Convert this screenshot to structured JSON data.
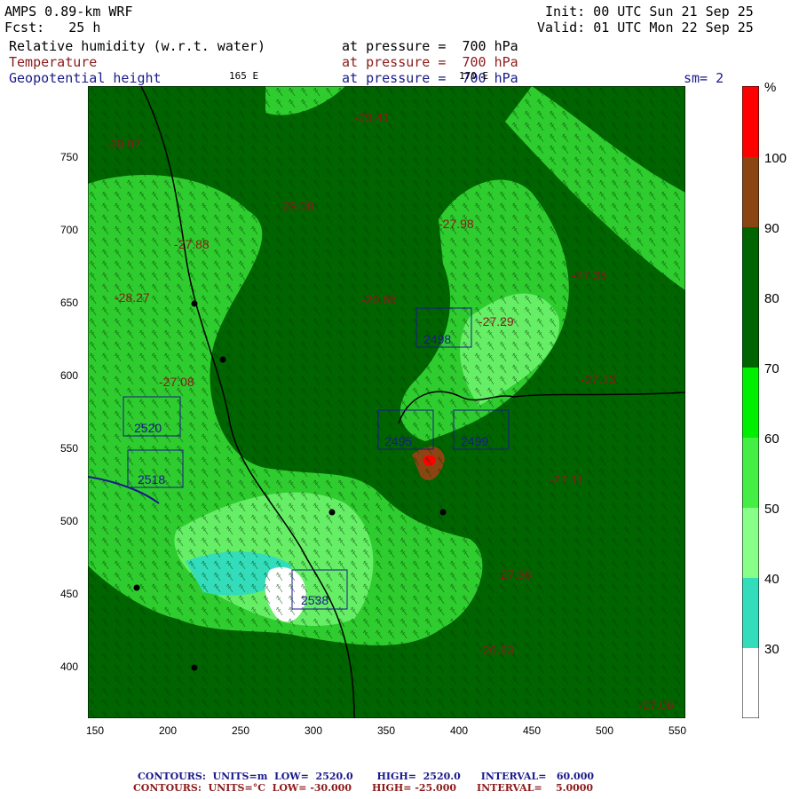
{
  "header": {
    "model": "AMPS 0.89-km WRF",
    "init": "Init: 00 UTC Sun 21 Sep 25",
    "fcst": "Fcst:   25 h",
    "valid": "Valid: 01 UTC Mon 22 Sep 25",
    "fields": [
      {
        "name": "Relative humidity (w.r.t. water)",
        "level": "at pressure =  700 hPa"
      },
      {
        "name": "Temperature",
        "level": "at pressure =  700 hPa"
      },
      {
        "name": "Geopotential height",
        "level": "at pressure =  700 hPa"
      }
    ],
    "lon_165": "165 E",
    "lon_170": "170 E",
    "sm": "sm= 2"
  },
  "axes": {
    "x_ticks": [
      "150",
      "200",
      "250",
      "300",
      "350",
      "400",
      "450",
      "500",
      "550"
    ],
    "y_ticks": [
      "750",
      "700",
      "650",
      "600",
      "550",
      "500",
      "450",
      "400"
    ]
  },
  "colorbar": {
    "unit": "%",
    "labels": [
      "100",
      "90",
      "80",
      "70",
      "60",
      "50",
      "40",
      "30"
    ],
    "colors": [
      "#ff0000",
      "#8b4513",
      "#006400",
      "#00a000",
      "#33ee33",
      "#66ee66",
      "#99ff99",
      "#33ddbb",
      "#ffffff"
    ]
  },
  "map_labels": {
    "temps": [
      "-29.07",
      "-29.41",
      "-29.08",
      "-27.35",
      "-28.27",
      "-27.29",
      "-27.13",
      "-27.11",
      "-27.08",
      "-27.36",
      "-26.93",
      "-27.06",
      "-27.88",
      "-27.98",
      "-29.65"
    ],
    "heights": [
      "2520",
      "2518",
      "2498",
      "2495",
      "2499",
      "2538"
    ]
  },
  "footer": {
    "line1": "CONTOURS:  UNITS=m  LOW=  2520.0       HIGH=  2520.0      INTERVAL=   60.000",
    "line2": "CONTOURS:  UNITS=°C  LOW= -30.000      HIGH= -25.000      INTERVAL=    5.0000"
  }
}
